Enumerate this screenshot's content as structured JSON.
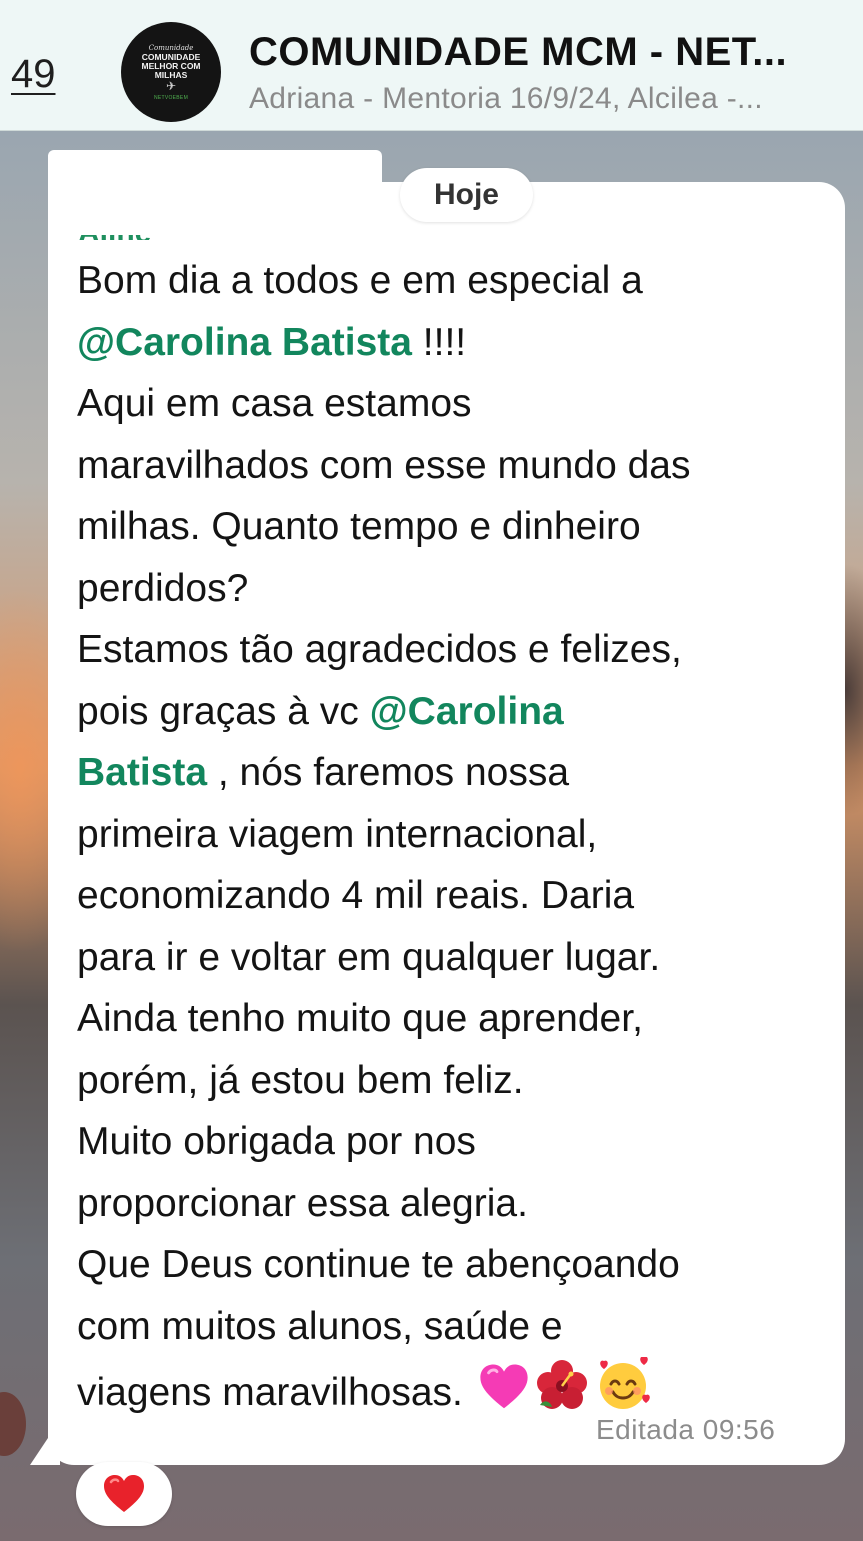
{
  "header": {
    "back_count": "49",
    "title": "COMUNIDADE MCM - NET...",
    "subtitle": "Adriana - Mentoria 16/9/24, Alcilea -...",
    "avatar": {
      "script_text": "Comunidade",
      "main_text": "COMUNIDADE MELHOR COM MILHAS",
      "sub_text": "NETVOEBEM"
    }
  },
  "chat": {
    "date_chip": "Hoje",
    "sender_stub": "Aline",
    "message_lines": [
      {
        "segments": [
          {
            "text": "Bom dia a todos e em especial a"
          }
        ]
      },
      {
        "segments": [
          {
            "text": "@Carolina Batista",
            "mention": true
          },
          {
            "text": " !!!!"
          }
        ]
      },
      {
        "segments": [
          {
            "text": "Aqui em casa estamos"
          }
        ]
      },
      {
        "segments": [
          {
            "text": "maravilhados com esse mundo das"
          }
        ]
      },
      {
        "segments": [
          {
            "text": "milhas. Quanto tempo e dinheiro"
          }
        ]
      },
      {
        "segments": [
          {
            "text": "perdidos?"
          }
        ]
      },
      {
        "segments": [
          {
            "text": "Estamos tão agradecidos e felizes,"
          }
        ]
      },
      {
        "segments": [
          {
            "text": "pois graças à vc "
          },
          {
            "text": "@Carolina",
            "mention": true
          }
        ]
      },
      {
        "segments": [
          {
            "text": "Batista",
            "mention": true
          },
          {
            "text": " , nós faremos nossa"
          }
        ]
      },
      {
        "segments": [
          {
            "text": "primeira viagem internacional,"
          }
        ]
      },
      {
        "segments": [
          {
            "text": "economizando 4 mil reais. Daria"
          }
        ]
      },
      {
        "segments": [
          {
            "text": "para ir e voltar em qualquer lugar."
          }
        ]
      },
      {
        "segments": [
          {
            "text": "Ainda tenho muito que aprender,"
          }
        ]
      },
      {
        "segments": [
          {
            "text": "porém, já estou bem feliz."
          }
        ]
      },
      {
        "segments": [
          {
            "text": "Muito obrigada por nos"
          }
        ]
      },
      {
        "segments": [
          {
            "text": "proporcionar essa alegria."
          }
        ]
      },
      {
        "segments": [
          {
            "text": "Que Deus continue te abençoando"
          }
        ]
      },
      {
        "segments": [
          {
            "text": "com muitos alunos, saúde e"
          }
        ]
      },
      {
        "segments": [
          {
            "text": "viagens maravilhosas. "
          }
        ]
      }
    ],
    "trailing_emojis": [
      "pink-heart-icon",
      "hibiscus-icon",
      "smiling-face-with-hearts-icon"
    ],
    "timestamp": "Editada 09:56",
    "reaction": "red-heart-icon",
    "colors": {
      "mention": "#12865d",
      "header_bg": "#eef7f6",
      "bubble_bg": "#ffffff"
    }
  }
}
